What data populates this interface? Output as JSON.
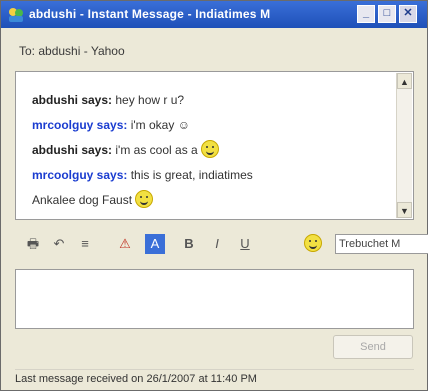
{
  "window": {
    "title": "abdushi - Instant Message - Indiatimes M",
    "buttons": {
      "minimize": "_",
      "maximize": "□",
      "close": "✕"
    }
  },
  "to_line": "To: abdushi - Yahoo",
  "conversation": [
    {
      "sender": "abdushi says:",
      "text": "hey how r u?",
      "sender_color": "#222222",
      "smiley": false
    },
    {
      "sender": "mrcoolguy says:",
      "text": "i'm okay ☺",
      "sender_color": "#1a3cd0",
      "smiley": false
    },
    {
      "sender": "abdushi says:",
      "text": "i'm as cool as a",
      "sender_color": "#222222",
      "smiley": true
    },
    {
      "sender": "mrcoolguy says:",
      "text": "this is great, indiatimes",
      "sender_color": "#1a3cd0",
      "smiley": false
    }
  ],
  "typing_line": "Ankalee dog Faust",
  "scrollbar": {
    "up": "▲",
    "down": "▼"
  },
  "toolbar": {
    "icons": [
      "print-icon",
      "undo-icon",
      "list-icon",
      "alert-icon",
      "font-icon",
      "bold-icon",
      "italic-icon",
      "underline-icon",
      "smiley-icon"
    ],
    "glyphs": [
      "🖶",
      "↶",
      "≡",
      "⚠",
      "A",
      "B",
      "I",
      "U",
      ""
    ],
    "font_select_value": "Trebuchet M"
  },
  "send_button": "Send",
  "status": "Last message received on 26/1/2007 at 11:40 PM"
}
